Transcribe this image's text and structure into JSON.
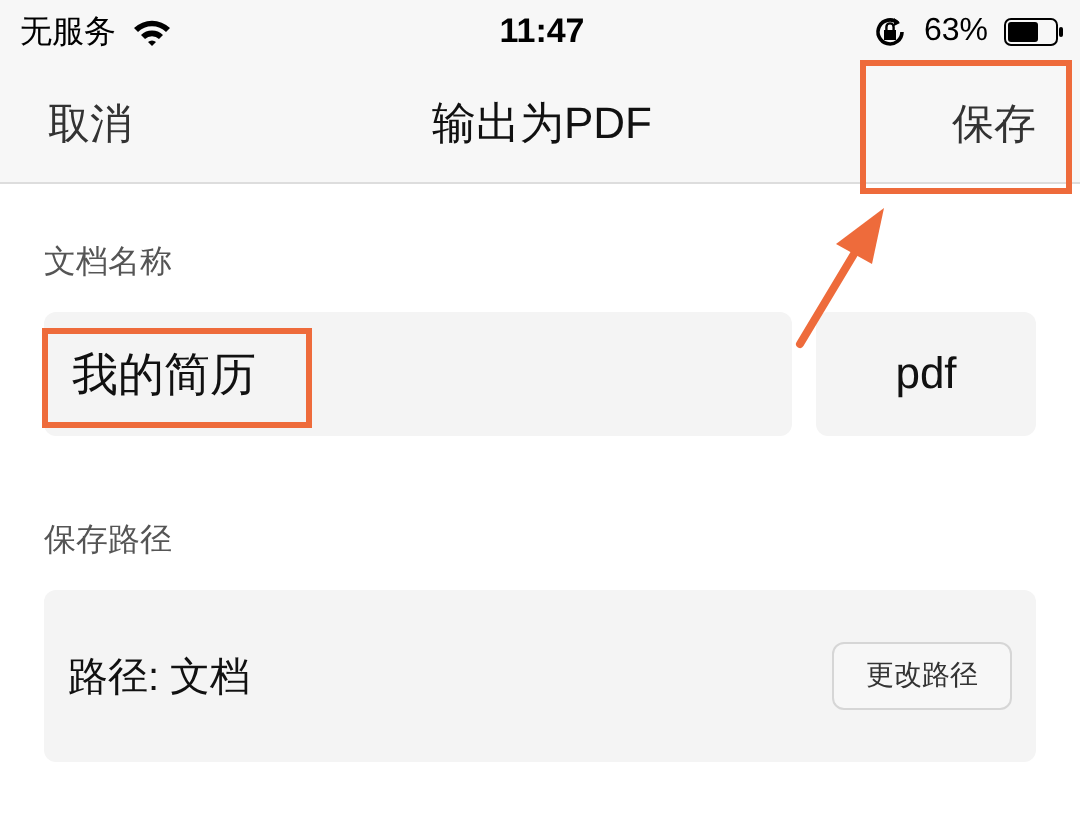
{
  "status_bar": {
    "carrier": "无服务",
    "time": "11:47",
    "battery": "63%"
  },
  "nav": {
    "cancel": "取消",
    "title": "输出为PDF",
    "save": {
      "label": "保存",
      "highlighted": true
    }
  },
  "document_name": {
    "label": "文档名称",
    "value": "我的简历",
    "highlighted": true,
    "extension": "pdf"
  },
  "save_path": {
    "label": "保存路径",
    "path": "路径: 文档",
    "change_button": "更改路径"
  }
}
